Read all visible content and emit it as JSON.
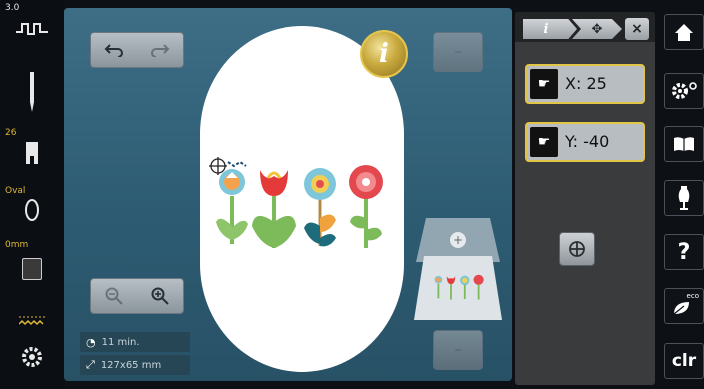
{
  "left_column": {
    "stitch_length": "3.0",
    "needle_value": "26",
    "hoop_name": "Oval",
    "thickness_value": "0mm"
  },
  "stage": {
    "stats": {
      "time_label": "11 min.",
      "size_label": "127x65 mm"
    }
  },
  "panel": {
    "x_label": "X: 25",
    "y_label": "Y: -40",
    "close_label": "×"
  },
  "menu": {
    "clr_label": "clr",
    "help_label": "?",
    "eco_label": "eco"
  },
  "colors": {
    "accent": "#e0c546",
    "stage": "#2f6077",
    "panel": "#3a3b3d"
  }
}
